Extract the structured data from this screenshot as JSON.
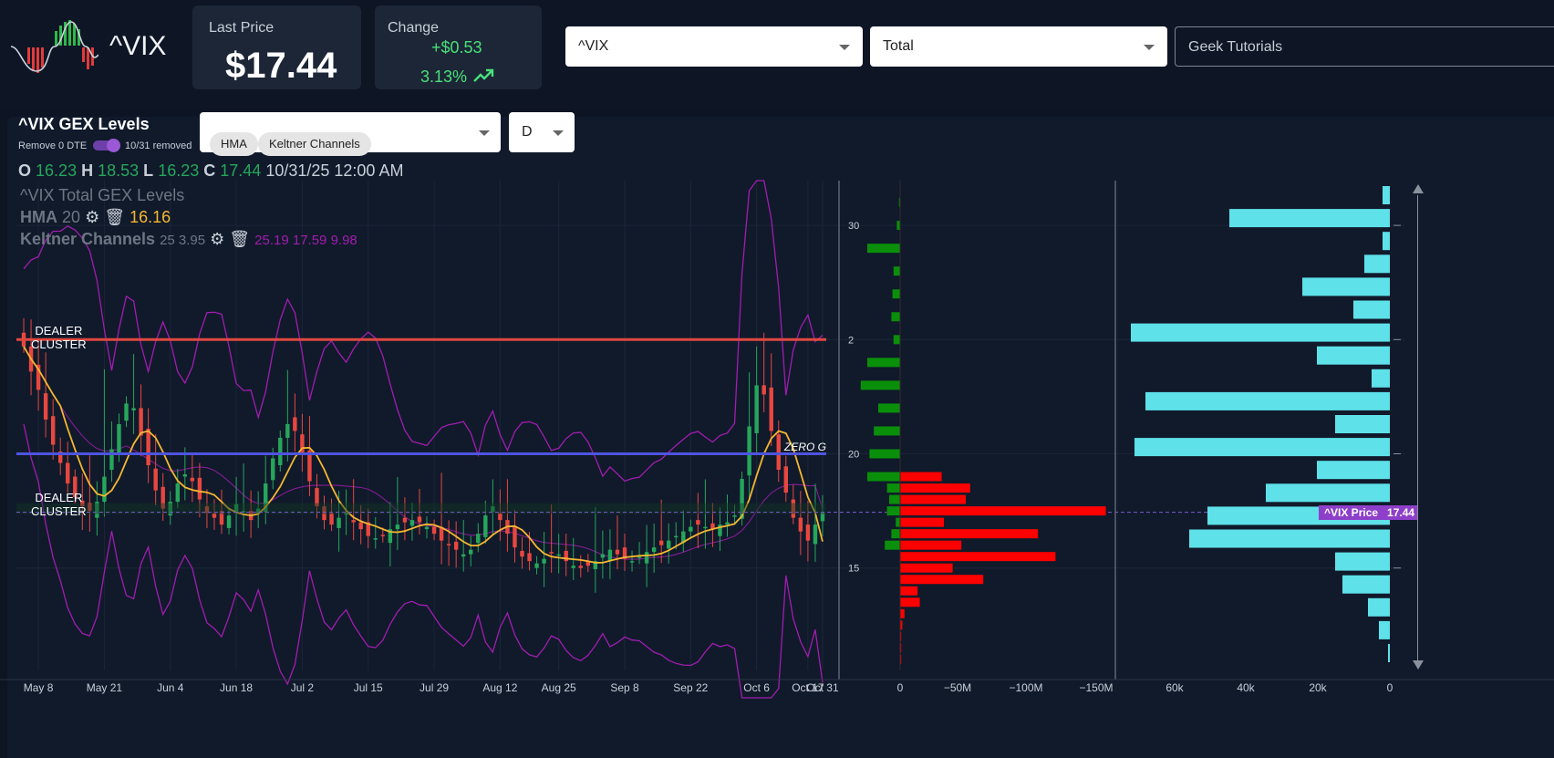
{
  "header": {
    "ticker": "^VIX",
    "last_price_label": "Last Price",
    "last_price": "$17.44",
    "change_label": "Change",
    "change_value": "+$0.53",
    "change_pct": "3.13%"
  },
  "controls": {
    "symbol_select": "^VIX",
    "type_select": "Total",
    "tutorials_input": "Geek Tutorials"
  },
  "chart_panel": {
    "title": "^VIX GEX Levels",
    "toggle_label": "Remove 0 DTE",
    "toggle_status": "10/31 removed",
    "indicator_chips": [
      "HMA",
      "Keltner Channels"
    ],
    "interval": "D"
  },
  "ohlc": {
    "o_label": "O",
    "o": "16.23",
    "h_label": "H",
    "h": "18.53",
    "l_label": "L",
    "l": "16.23",
    "c_label": "C",
    "c": "17.44",
    "datetime": "10/31/25 12:00 AM"
  },
  "legend": {
    "series_title": "^VIX Total GEX Levels",
    "hma_name": "HMA",
    "hma_param": "20",
    "hma_value": "16.16",
    "keltner_name": "Keltner Channels",
    "keltner_params": "25 3.95",
    "keltner_values": "25.19 17.59 9.98"
  },
  "annotations": {
    "dealer_cluster_top": [
      "DEALER",
      "CLUSTER"
    ],
    "dealer_cluster_bottom": [
      "DEALER",
      "CLUSTER"
    ],
    "zero_gamma": "ZERO G",
    "price_tag_label": "^VIX Price",
    "price_tag_value": "17.44"
  },
  "colors": {
    "bull": "#26a65b",
    "bear": "#e8473f",
    "hma": "#f5b731",
    "keltner": "#a21caf",
    "dealer_line": "#e0483f",
    "zero_gamma_line": "#4f54e0",
    "gex_call": "#0a8f0a",
    "gex_put": "#ff0000",
    "oi_bar": "#5ee1e9",
    "price_tag": "#8e3fc9",
    "change_green": "#48e07a"
  },
  "chart_data": [
    {
      "type": "candlestick",
      "title": "^VIX Total GEX Levels",
      "x_tick_labels": [
        "May 8",
        "May 21",
        "Jun 4",
        "Jun 18",
        "Jul 2",
        "Jul 15",
        "Jul 29",
        "Aug 12",
        "Aug 25",
        "Sep 8",
        "Sep 22",
        "Oct 6",
        "Oct 17",
        "Oct 31"
      ],
      "price_range": [
        11,
        33
      ],
      "horizontal_levels": [
        {
          "label": "DEALER CLUSTER",
          "value": 25
        },
        {
          "label": "ZERO G",
          "value": 20
        },
        {
          "label": "DEALER CLUSTER",
          "value": 17.6
        }
      ],
      "current_price": 17.44,
      "hma_last": 16.16,
      "keltner_last": {
        "upper": 25.19,
        "middle": 17.59,
        "lower": 9.98
      },
      "closes": [
        24.7,
        23.6,
        22.8,
        21.5,
        20.4,
        19.6,
        18.7,
        18.1,
        17.7,
        17.5,
        17.9,
        19.0,
        20.2,
        21.3,
        22.2,
        22.0,
        20.8,
        19.5,
        18.4,
        17.6,
        17.9,
        18.7,
        19.1,
        18.8,
        18.0,
        17.4,
        17.2,
        16.9,
        17.3,
        17.8,
        17.5,
        17.1,
        17.6,
        18.7,
        19.8,
        20.7,
        21.3,
        21.0,
        20.0,
        18.8,
        17.7,
        17.1,
        16.9,
        17.2,
        17.4,
        17.0,
        16.7,
        16.4,
        16.3,
        16.4,
        16.7,
        16.9,
        17.0,
        17.1,
        17.0,
        16.8,
        16.5,
        16.2,
        16.0,
        15.8,
        15.6,
        15.8,
        16.5,
        17.3,
        17.7,
        17.1,
        16.5,
        15.9,
        15.5,
        15.3,
        15.2,
        15.4,
        15.7,
        15.6,
        15.3,
        15.1,
        15.0,
        15.1,
        15.3,
        15.6,
        15.8,
        15.6,
        15.4,
        15.3,
        15.5,
        15.7,
        15.9,
        16.0,
        16.2,
        16.4,
        16.6,
        16.8,
        16.9,
        16.8,
        16.7,
        16.9,
        17.0,
        17.3,
        18.9,
        21.2,
        23.0,
        22.6,
        21.0,
        19.3,
        18.3,
        17.2,
        16.6,
        16.2,
        16.9,
        17.44
      ],
      "gex_strikes": [
        31,
        30,
        29,
        28,
        27,
        26,
        25,
        24,
        23,
        22,
        21,
        20,
        19,
        18.5,
        18,
        17.5,
        17,
        16.5,
        16,
        15.5,
        15,
        14.5,
        14,
        13.5,
        13,
        12.5,
        12,
        11.5,
        11
      ],
      "gex_call_values_M": [
        0.5,
        1.5,
        15,
        3,
        3.5,
        4,
        3,
        15,
        18,
        10,
        12,
        14,
        15,
        6,
        5,
        6,
        2,
        4,
        7,
        0,
        0,
        0,
        0,
        0,
        0,
        0,
        0,
        0,
        0
      ],
      "gex_put_values_M": [
        0,
        0,
        0,
        0,
        0,
        0,
        0,
        0,
        0,
        0,
        0,
        0,
        19,
        32,
        30,
        94,
        20,
        63,
        28,
        71,
        24,
        38,
        8,
        9,
        2,
        1,
        0.5,
        0.5,
        0.5
      ],
      "gex_axis_labels": [
        "0",
        "−50M",
        "−100M",
        "−150M"
      ],
      "oi_axis_labels": [
        "60k",
        "40k",
        "20k",
        "0"
      ],
      "oi_values_k": [
        2,
        44,
        2,
        7,
        24,
        10,
        71,
        20,
        5,
        67,
        15,
        70,
        20,
        34,
        50,
        55,
        15,
        13,
        6,
        3,
        0.5
      ],
      "y_axis_labels": [
        {
          "label": "30",
          "value": 30
        },
        {
          "label": "2",
          "value": 25
        },
        {
          "label": "20",
          "value": 20
        },
        {
          "label": "15",
          "value": 15
        }
      ]
    }
  ]
}
